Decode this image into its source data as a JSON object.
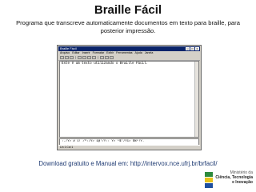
{
  "slide": {
    "title": "Braille Fácil",
    "subtitle": "Programa que transcreve automaticamente documentos em texto para braille, para posterior impressão.",
    "footer": "Download gratuito e Manual em: http://intervox.nce.ufrj.br/brfacil/"
  },
  "app_window": {
    "title": "Braille Fácil",
    "controls": {
      "minimize": "_",
      "maximize": "□",
      "close": "×"
    },
    "menus": [
      "Arquivo",
      "Editar",
      "Inserir",
      "Formatar",
      "Exibir",
      "Ferramentas",
      "Ajuda",
      "Janela"
    ],
    "toolbar_icons": [
      "new-icon",
      "open-icon",
      "save-icon",
      "print-icon",
      "cut-icon",
      "copy-icon",
      "paste-icon",
      "undo-icon",
      "braille-icon",
      "help-icon"
    ],
    "editor_text": "Este é um texto utilizando o Braille Fácil.",
    "braille_preview": ":-/Y> # 1! /^:/Y> 1@'/Y:: Y> *$'/Y1> $%*!Y.",
    "status": "Lin 1  Col 1"
  },
  "logo": {
    "line1": "Ministério da",
    "line2": "Ciência, Tecnologia",
    "line3": "e Inovação"
  },
  "colors": {
    "titlebar": "#0a246a",
    "footer_text": "#1f3b73",
    "logo_green": "#2e8b3d",
    "logo_yellow": "#e8c21a",
    "logo_blue": "#1f4fa0"
  }
}
